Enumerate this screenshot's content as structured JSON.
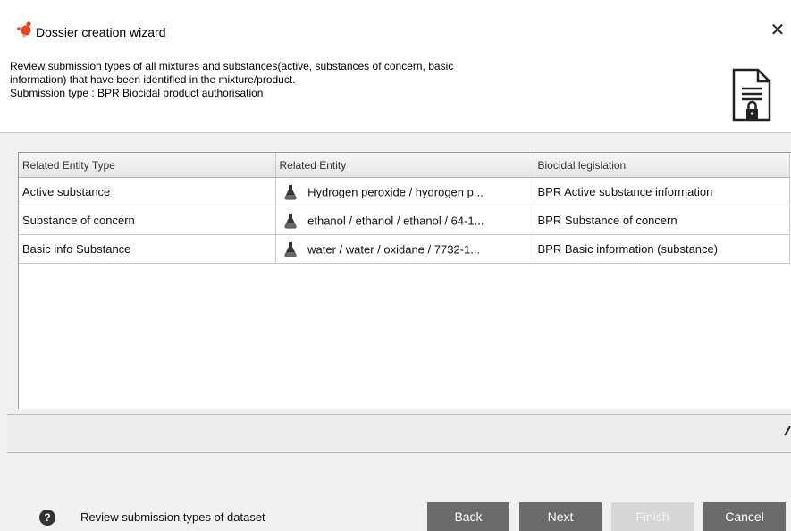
{
  "window": {
    "title": "Dossier creation wizard",
    "close_glyph": "✕"
  },
  "header": {
    "description_lines": [
      "Review submission types of all mixtures and substances(active, substances of concern, basic",
      "information) that have been identified in the mixture/product.",
      "Submission type : BPR Biocidal product authorisation"
    ],
    "icon": "secured-document-icon"
  },
  "table": {
    "columns": [
      "Related Entity Type",
      "Related Entity",
      "Biocidal legislation"
    ],
    "rows": [
      {
        "type": "Active substance",
        "entity": "Hydrogen peroxide / hydrogen p...",
        "legislation": "BPR Active substance information"
      },
      {
        "type": "Substance of concern",
        "entity": "ethanol / ethanol / ethanol / 64-1...",
        "legislation": "BPR Substance of concern"
      },
      {
        "type": "Basic info Substance",
        "entity": "water / water / oxidane / 7732-1...",
        "legislation": "BPR Basic information (substance)"
      }
    ]
  },
  "footer": {
    "help_glyph": "?",
    "help_text": "Review submission types of dataset",
    "buttons": {
      "back": "Back",
      "next": "Next",
      "finish": "Finish",
      "cancel": "Cancel"
    }
  },
  "colors": {
    "button": "#6b6b6b",
    "button_disabled": "#d6d6d6",
    "app_icon": "#e8461e"
  }
}
